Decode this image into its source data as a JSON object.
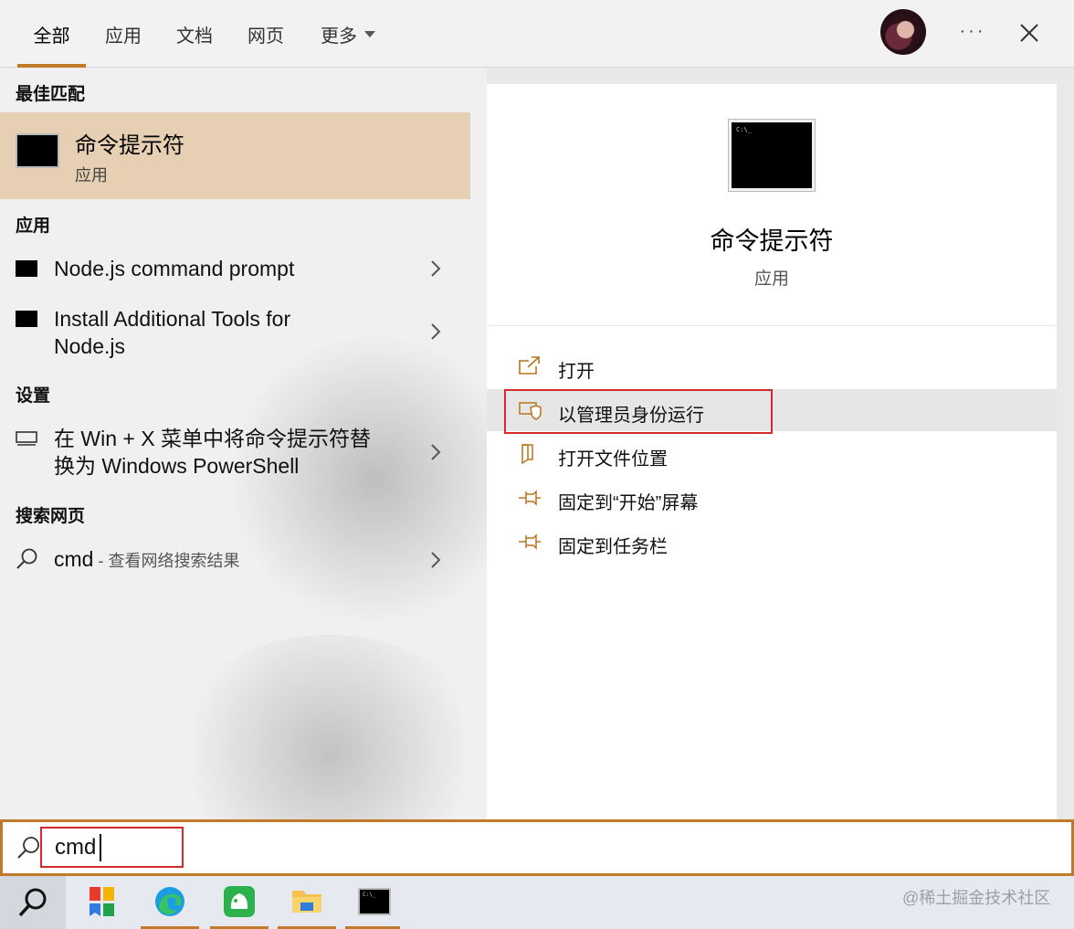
{
  "header": {
    "tabs": [
      {
        "label": "全部",
        "active": true
      },
      {
        "label": "应用",
        "active": false
      },
      {
        "label": "文档",
        "active": false
      },
      {
        "label": "网页",
        "active": false
      },
      {
        "label": "更多",
        "active": false
      }
    ],
    "more_icon": "ellipsis-icon",
    "close_icon": "close-icon"
  },
  "left": {
    "best_match_title": "最佳匹配",
    "best_match": {
      "name": "命令提示符",
      "type": "应用",
      "icon": "cmd-icon"
    },
    "apps_title": "应用",
    "apps": [
      {
        "label": "Node.js command prompt"
      },
      {
        "label_line1": "Install Additional Tools for",
        "label_line2": "Node.js"
      }
    ],
    "settings_title": "设置",
    "settings_item": {
      "line1": "在 Win + X 菜单中将命令提示符替",
      "line2": "换为 Windows PowerShell"
    },
    "web_title": "搜索网页",
    "web_item": {
      "query": "cmd",
      "hint": " - 查看网络搜索结果"
    }
  },
  "right": {
    "title": "命令提示符",
    "subtitle": "应用",
    "icon_text": "C:\\_",
    "actions": [
      {
        "label": "打开",
        "icon": "open-icon"
      },
      {
        "label": "以管理员身份运行",
        "icon": "shield-icon"
      },
      {
        "label": "打开文件位置",
        "icon": "file-location-icon"
      },
      {
        "label": "固定到“开始”屏幕",
        "icon": "pin-icon"
      },
      {
        "label": "固定到任务栏",
        "icon": "pin-icon"
      }
    ]
  },
  "search": {
    "value": "cmd"
  },
  "taskbar": {
    "items": [
      "search-icon",
      "start-tiles-icon",
      "edge-icon",
      "android-app-icon",
      "file-explorer-icon",
      "cmd-icon"
    ],
    "watermark": "@稀土掘金技术社区"
  },
  "colors": {
    "accent": "#c07a2a",
    "highlight": "#e6cfb2",
    "redbox": "#d42a2a"
  }
}
